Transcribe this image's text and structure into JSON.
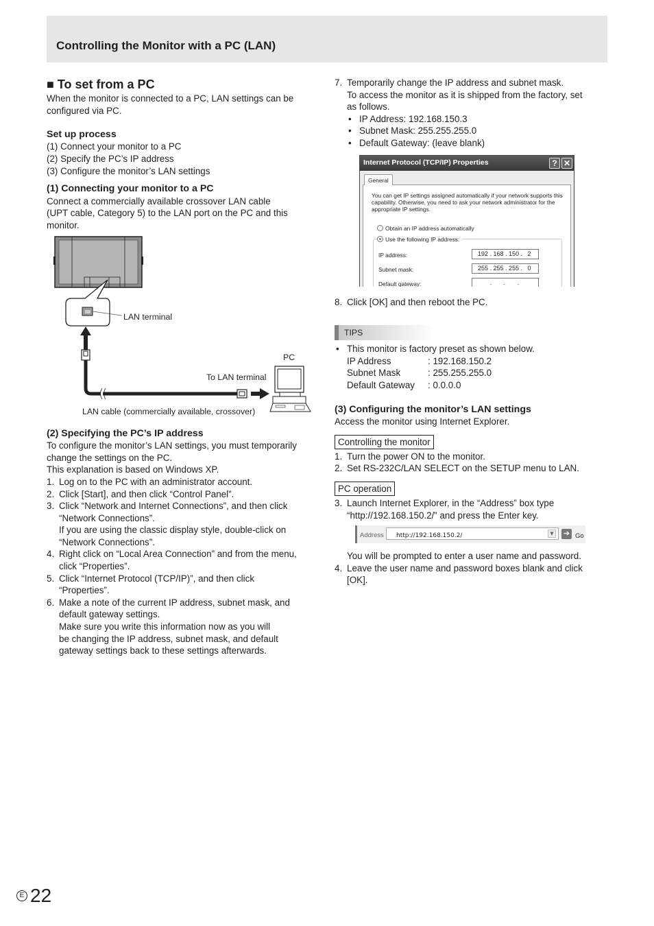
{
  "header": {
    "title": "Controlling the Monitor with a PC (LAN)"
  },
  "left": {
    "section_title": "■ To set from a PC",
    "intro": [
      "When the monitor is connected to a PC, LAN settings can be",
      "configured via PC."
    ],
    "setup": {
      "title": "Set up process",
      "items": [
        "(1) Connect your monitor to a PC",
        "(2) Specify the PC’s IP address",
        "(3) Configure the monitor’s LAN settings"
      ]
    },
    "connect": {
      "title": "(1) Connecting your monitor to a PC",
      "lines": [
        "Connect a commercially available crossover LAN cable",
        "(UPT cable, Category 5) to the LAN  port on the PC and this",
        "monitor."
      ],
      "diagram": {
        "lan_terminal": "LAN terminal",
        "pc": "PC",
        "to_lan_terminal": "To LAN terminal",
        "cable": "LAN cable (commercially available, crossover)"
      }
    },
    "specify": {
      "title": "(2) Specifying the PC’s IP address",
      "lines": [
        "To configure the monitor’s LAN settings, you must temporarily",
        "change the settings on the PC.",
        "This explanation is based on Windows XP."
      ],
      "steps": [
        {
          "num": "1.",
          "lines": [
            "Log on to the PC with an administrator account."
          ]
        },
        {
          "num": "2.",
          "lines": [
            "Click [Start], and then click “Control Panel”."
          ]
        },
        {
          "num": "3.",
          "lines": [
            "Click “Network and Internet Connections”, and then click",
            "“Network Connections”.",
            "If you are using the classic display style, double-click on",
            "“Network Connections”."
          ]
        },
        {
          "num": "4.",
          "lines": [
            "Right click on “Local Area Connection” and from the menu,",
            "click “Properties”."
          ]
        },
        {
          "num": "5.",
          "lines": [
            "Click “Internet Protocol (TCP/IP)”, and then click",
            "“Properties”."
          ]
        },
        {
          "num": "6.",
          "lines": [
            "Make a note of the current IP address, subnet mask, and",
            "default gateway settings.",
            "Make sure you write this information now as you will",
            "be changing the IP address, subnet mask, and default",
            "gateway settings back to these settings afterwards."
          ]
        }
      ]
    }
  },
  "right": {
    "step7": {
      "num": "7.",
      "lines": [
        "Temporarily change the IP address and subnet mask.",
        "To access the monitor as it is shipped from the factory, set",
        "as follows."
      ],
      "bullets": [
        "IP Address: 192.168.150.3",
        "Subnet Mask: 255.255.255.0",
        "Default Gateway: (leave blank)"
      ]
    },
    "dialog": {
      "title": "Internet Protocol (TCP/IP) Properties",
      "help": "?",
      "close": "✕",
      "tab": "General",
      "intro": "You can get IP settings assigned automatically if your network supports this capability. Otherwise, you need to ask your network administrator for the appropriate IP settings.",
      "radio_auto": "Obtain an IP address automatically",
      "radio_manual": "Use the following IP address:",
      "selected": "manual",
      "fields": [
        {
          "label": "IP address:",
          "value": "192 . 168 . 150 .   2"
        },
        {
          "label": "Subnet mask:",
          "value": "255 . 255 . 255 .   0"
        },
        {
          "label": "Default gateway:",
          "value": "       .       .       ."
        }
      ]
    },
    "step8": {
      "num": "8.",
      "text": "Click [OK] and then reboot the PC."
    },
    "tips": {
      "label": "TIPS",
      "bullet": "This monitor is factory preset as shown below.",
      "rows": [
        {
          "key": "IP Address",
          "value": ": 192.168.150.2"
        },
        {
          "key": "Subnet Mask",
          "value": ": 255.255.255.0"
        },
        {
          "key": "Default Gateway",
          "value": ": 0.0.0.0"
        }
      ]
    },
    "configure": {
      "title": "(3) Configuring the monitor’s LAN settings",
      "intro": "Access the monitor using Internet Explorer.",
      "box1": "Controlling the monitor",
      "steps_a": [
        {
          "num": "1.",
          "lines": [
            "Turn the power ON to the monitor."
          ]
        },
        {
          "num": "2.",
          "lines": [
            "Set RS-232C/LAN SELECT on the SETUP menu to LAN."
          ]
        }
      ],
      "box2": "PC operation",
      "step3": {
        "num": "3.",
        "lines": [
          "Launch Internet Explorer, in the “Address” box type",
          "“http://192.168.150.2/” and press the Enter key."
        ]
      },
      "address_bar": {
        "label": "Address",
        "value": "http://192.168.150.2/",
        "go": "Go"
      },
      "prompt": "You will be prompted to enter a user name and password.",
      "step4": {
        "num": "4.",
        "lines": [
          "Leave the user name and password boxes blank and click",
          "[OK]."
        ]
      }
    }
  },
  "footer": {
    "lang": "E",
    "page": "22"
  }
}
